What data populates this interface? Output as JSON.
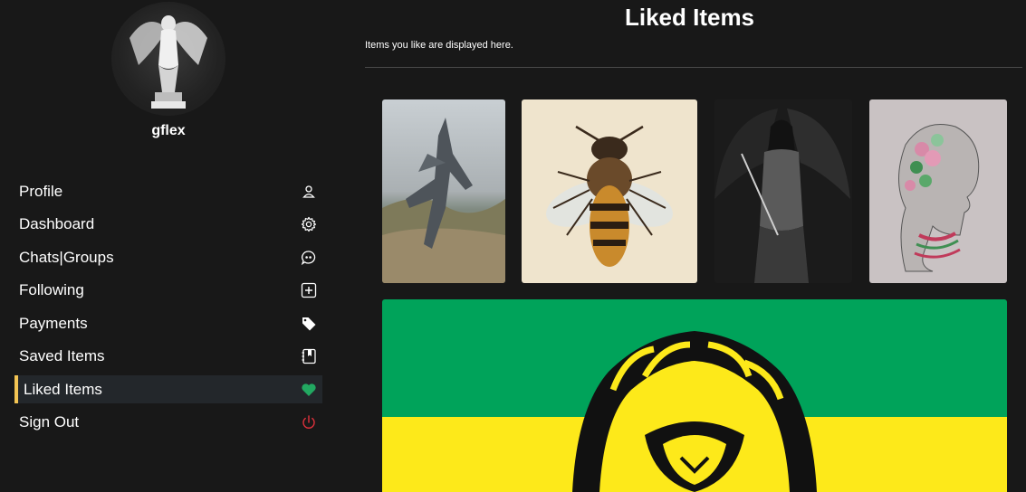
{
  "user": {
    "username": "gflex"
  },
  "nav": {
    "items": [
      {
        "label": "Profile",
        "icon": "user-icon"
      },
      {
        "label": "Dashboard",
        "icon": "gear-icon"
      },
      {
        "label": "Chats|Groups",
        "icon": "chat-icon"
      },
      {
        "label": "Following",
        "icon": "plus-square-icon"
      },
      {
        "label": "Payments",
        "icon": "tag-icon"
      },
      {
        "label": "Saved Items",
        "icon": "bookmark-book-icon"
      },
      {
        "label": "Liked Items",
        "icon": "heart-icon",
        "active": true
      },
      {
        "label": "Sign Out",
        "icon": "power-icon"
      }
    ]
  },
  "page": {
    "title": "Liked Items",
    "subtitle": "Items you like are displayed here."
  },
  "items": [
    {
      "subject": "fighter jet"
    },
    {
      "subject": "honey bee illustration"
    },
    {
      "subject": "dark winged warrior woman"
    },
    {
      "subject": "floral profile sketch"
    },
    {
      "subject": "lion flag"
    }
  ],
  "colors": {
    "background": "#181818",
    "active_bg": "#23272b",
    "active_bar": "#f3c453",
    "heart": "#22a861",
    "signout": "#e0313c",
    "flag_green": "#00a35a",
    "flag_yellow": "#fde91a"
  }
}
